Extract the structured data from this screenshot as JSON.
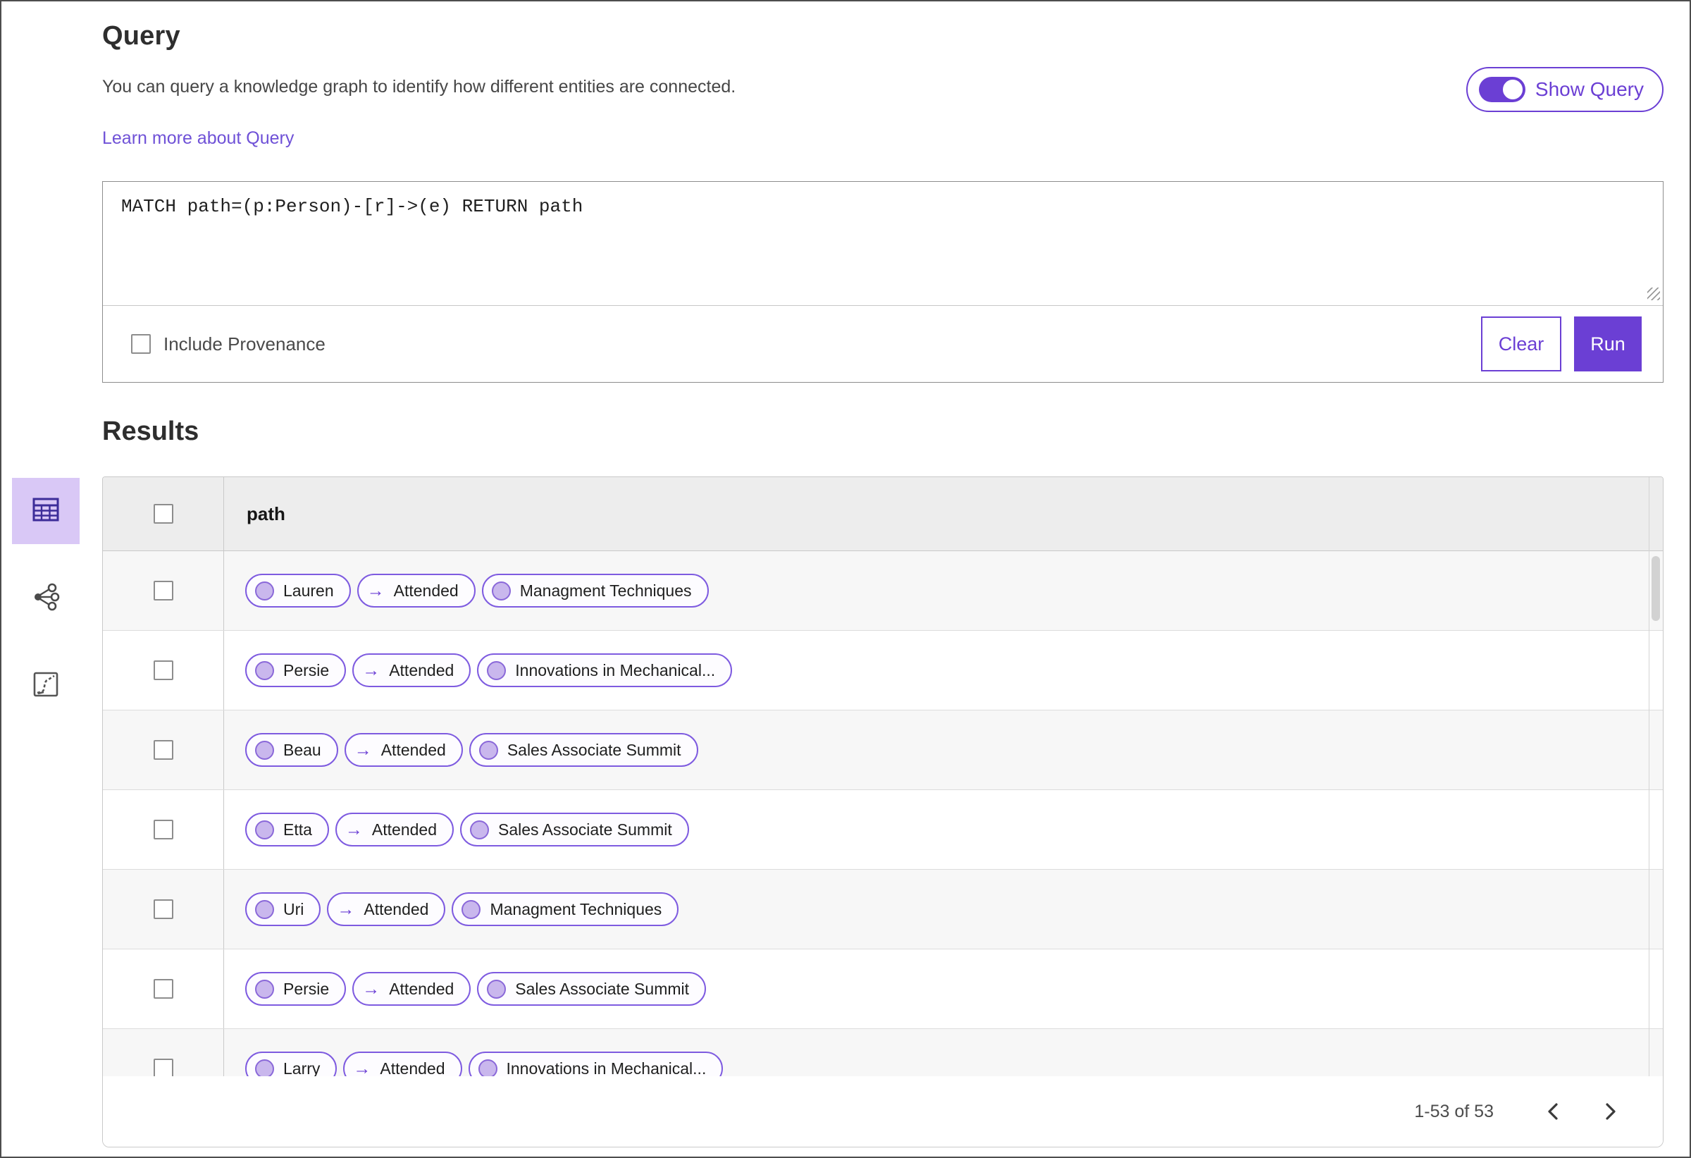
{
  "query_section": {
    "title": "Query",
    "description": "You can query a knowledge graph to identify how different entities are connected.",
    "learn_more_label": "Learn more about Query",
    "show_query_label": "Show Query",
    "show_query_toggle_state": "on",
    "query_text": "MATCH path=(p:Person)-[r]->(e) RETURN path",
    "include_provenance_label": "Include Provenance",
    "include_provenance_checked": false,
    "clear_label": "Clear",
    "run_label": "Run"
  },
  "results_section": {
    "title": "Results",
    "column_header": "path",
    "view_options": [
      {
        "name": "table-view",
        "selected": true
      },
      {
        "name": "graph-view",
        "selected": false
      },
      {
        "name": "chart-view",
        "selected": false
      }
    ],
    "edge_arrow_glyph": "→",
    "rows": [
      {
        "source": "Lauren",
        "edge": "Attended",
        "target": "Managment Techniques"
      },
      {
        "source": "Persie",
        "edge": "Attended",
        "target": "Innovations in Mechanical..."
      },
      {
        "source": "Beau",
        "edge": "Attended",
        "target": "Sales Associate Summit"
      },
      {
        "source": "Etta",
        "edge": "Attended",
        "target": "Sales Associate Summit"
      },
      {
        "source": "Uri",
        "edge": "Attended",
        "target": "Managment Techniques"
      },
      {
        "source": "Persie",
        "edge": "Attended",
        "target": "Sales Associate Summit"
      },
      {
        "source": "Larry",
        "edge": "Attended",
        "target": "Innovations in Mechanical..."
      }
    ],
    "pagination": {
      "range_label": "1-53 of 53",
      "prev_icon": "chevron-left-icon",
      "next_icon": "chevron-right-icon"
    }
  },
  "colors": {
    "accent_purple": "#6b3fd4",
    "pill_border": "#7e5be0",
    "node_dot_fill": "#c9b7ed",
    "node_dot_border": "#8a68d9",
    "selected_rail_bg": "#d9c8f6",
    "header_row_bg": "#ededed",
    "odd_row_bg": "#f7f7f7",
    "link_color": "#6f51d7"
  }
}
